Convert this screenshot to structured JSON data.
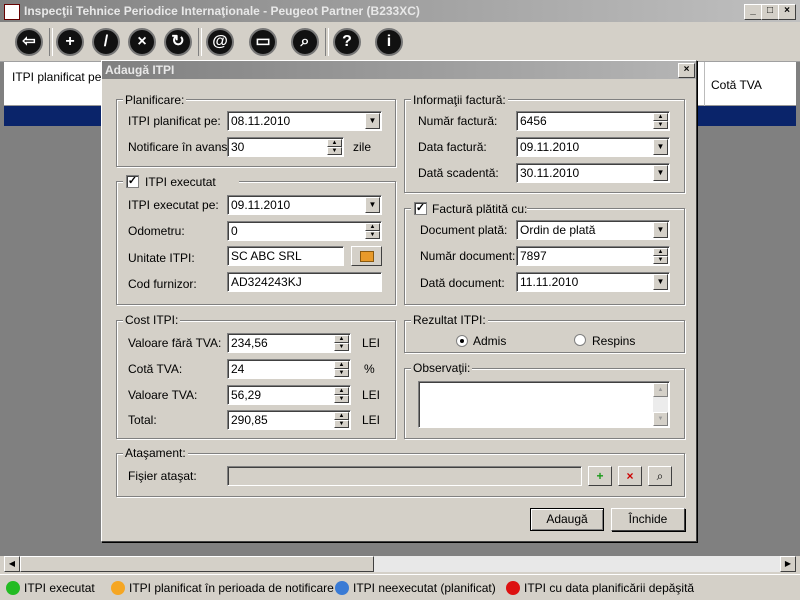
{
  "window": {
    "title": "Inspecţii Tehnice Periodice Internaţionale - Peugeot Partner (B233XC)"
  },
  "grid": {
    "col1": "ITPI planificat pe",
    "col_last": "Cotă TVA"
  },
  "dialog": {
    "title": "Adaugă ITPI",
    "planificare": {
      "group": "Planificare:",
      "planned_label": "ITPI planificat pe:",
      "planned_value": "08.11.2010",
      "notice_label": "Notificare în avans:",
      "notice_value": "30",
      "notice_unit": "zile"
    },
    "executat": {
      "group": "ITPI executat",
      "checked": "✓",
      "exec_label": "ITPI executat pe:",
      "exec_value": "09.11.2010",
      "odo_label": "Odometru:",
      "odo_value": "0",
      "unit_label": "Unitate ITPI:",
      "unit_value": "SC ABC SRL",
      "cod_label": "Cod furnizor:",
      "cod_value": "AD324243KJ"
    },
    "cost": {
      "group": "Cost ITPI:",
      "v1_label": "Valoare fără TVA:",
      "v1_value": "234,56",
      "v1_unit": "LEI",
      "v2_label": "Cotă TVA:",
      "v2_value": "24",
      "v2_unit": "%",
      "v3_label": "Valoare TVA:",
      "v3_value": "56,29",
      "v3_unit": "LEI",
      "v4_label": "Total:",
      "v4_value": "290,85",
      "v4_unit": "LEI"
    },
    "factura": {
      "group": "Informaţii factură:",
      "nr_label": "Număr factură:",
      "nr_value": "6456",
      "data_label": "Data factură:",
      "data_value": "09.11.2010",
      "scad_label": "Dată scadentă:",
      "scad_value": "30.11.2010"
    },
    "platita": {
      "group": "Factură plătită cu:",
      "checked": "✓",
      "doc_label": "Document plată:",
      "doc_value": "Ordin de plată",
      "ndoc_label": "Număr document:",
      "ndoc_value": "7897",
      "ddoc_label": "Dată document:",
      "ddoc_value": "11.11.2010"
    },
    "rezultat": {
      "group": "Rezultat ITPI:",
      "admis": "Admis",
      "respins": "Respins"
    },
    "obs": {
      "group": "Observaţii:"
    },
    "atasament": {
      "group": "Ataşament:",
      "file_label": "Fişier ataşat:"
    },
    "buttons": {
      "add": "Adaugă",
      "close": "Închide"
    }
  },
  "legend": [
    {
      "label": "ITPI executat",
      "color": "#22bb22"
    },
    {
      "label": "ITPI planificat în perioada de notificare",
      "color": "#f5a623"
    },
    {
      "label": "ITPI neexecutat (planificat)",
      "color": "#3a7bd5"
    },
    {
      "label": "ITPI cu data planificării depăşită",
      "color": "#dd1111"
    }
  ]
}
